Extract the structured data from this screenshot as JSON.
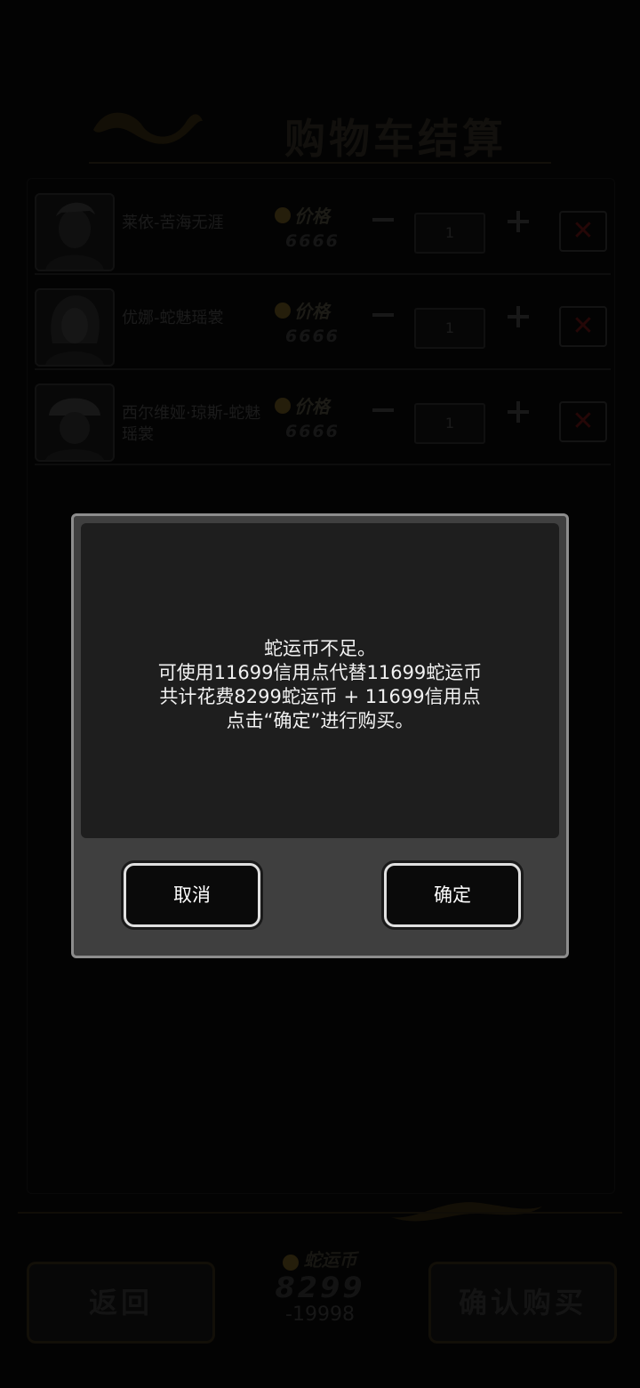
{
  "header": {
    "title": "购物车结算"
  },
  "cart": {
    "items": [
      {
        "name": "莱依-苦海无涯",
        "price_label": "价格",
        "price": "6666",
        "qty": "1"
      },
      {
        "name": "优娜-蛇魅瑶裳",
        "price_label": "价格",
        "price": "6666",
        "qty": "1"
      },
      {
        "name": "西尔维娅·琼斯-蛇魅瑶裳",
        "price_label": "价格",
        "price": "6666",
        "qty": "1"
      }
    ]
  },
  "footer": {
    "back_label": "返回",
    "confirm_label": "确认购买",
    "currency_label": "蛇运币",
    "balance": "8299",
    "delta": "-19998"
  },
  "dialog": {
    "lines": [
      "蛇运币不足。",
      "可使用11699信用点代替11699蛇运币",
      "共计花费8299蛇运币 + 11699信用点",
      "点击“确定”进行购买。"
    ],
    "cancel_label": "取消",
    "ok_label": "确定"
  },
  "colors": {
    "dialog_bg": "#3f3f3f",
    "dialog_border": "#8d8d8d",
    "accent_gold": "#3a2e12"
  }
}
